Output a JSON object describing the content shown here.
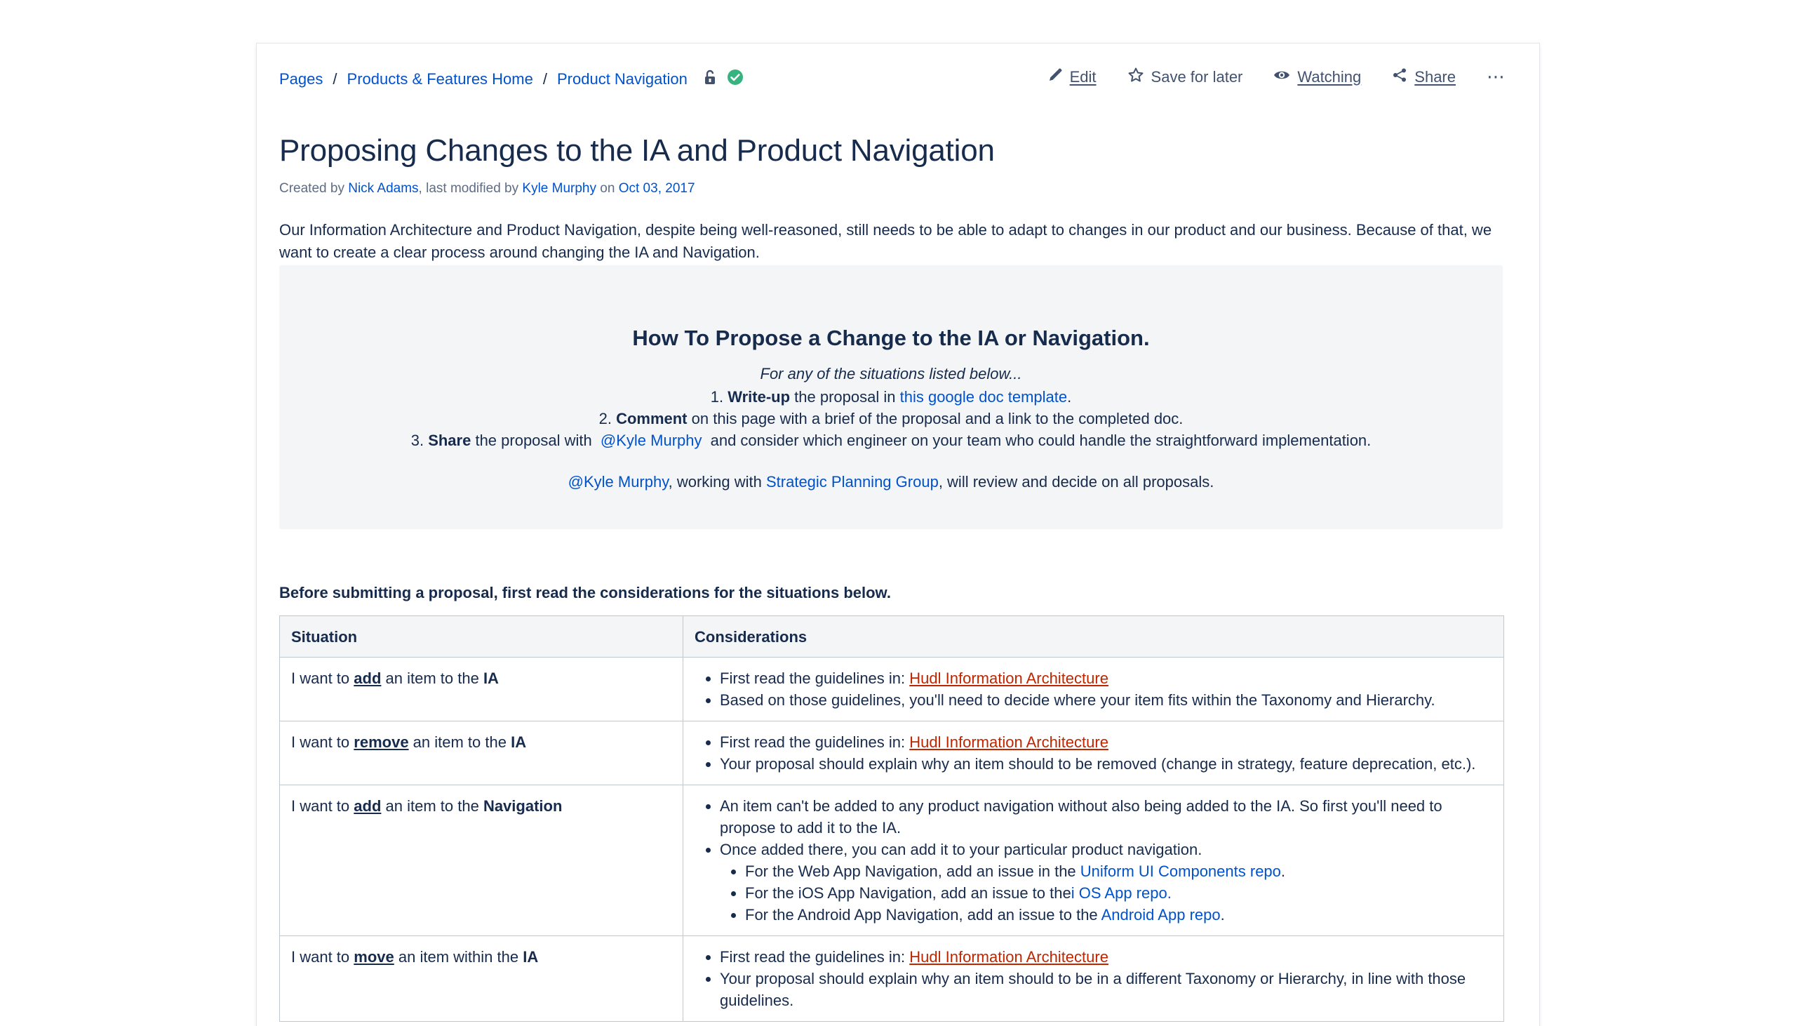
{
  "breadcrumb": {
    "pages": "Pages",
    "home": "Products & Features Home",
    "current": "Product Navigation",
    "separator": "/"
  },
  "icons": {
    "restriction": "unlock-icon",
    "status": "check-circle-icon",
    "edit": "pencil-icon",
    "save": "star-icon",
    "watch": "eye-icon",
    "share": "share-icon",
    "more": "more-dots-icon"
  },
  "actions": {
    "edit": "Edit",
    "save": "Save for later",
    "watch": "Watching",
    "share": "Share",
    "more": "⋯"
  },
  "page": {
    "title": "Proposing Changes to the IA and Product Navigation",
    "created_by_label": "Created by",
    "creator": "Nick Adams",
    "modified_label": ", last modified by",
    "modifier": "Kyle Murphy",
    "on_label": "on",
    "date": "Oct 03, 2017",
    "intro": "Our Information Architecture and Product Navigation, despite being well-reasoned, still needs to be able to adapt to changes in our product and our business. Because of that, we want to create a clear process around changing the IA and Navigation."
  },
  "panel": {
    "heading": "How To Propose a Change to the IA or Navigation.",
    "lead": "For any of the situations listed below...",
    "step1": {
      "num": "1.",
      "bold": "Write-up",
      "text": " the proposal in ",
      "link": "this google doc template",
      "end": "."
    },
    "step2": {
      "num": "2.",
      "bold": "Comment",
      "text": " on this page with a brief of the proposal and a link to the completed doc."
    },
    "step3": {
      "num": "3.",
      "bold": "Share",
      "text": " the proposal with ",
      "mention": "@Kyle Murphy",
      "end": " and consider which engineer on your team who could handle the straightforward implementation."
    },
    "review": {
      "mention": "@Kyle Murphy",
      "text1": ", working with ",
      "link": "Strategic Planning Group",
      "text2": ", will review and decide on all proposals."
    }
  },
  "before_text": "Before submitting a proposal, first read the considerations for the situations below.",
  "table": {
    "headers": [
      "Situation",
      "Considerations"
    ],
    "rows": [
      {
        "s_pre": "I want to ",
        "s_verb": "add",
        "s_mid": " an item to the ",
        "s_obj": "IA",
        "c1_text": "First read the guidelines in: ",
        "c1_link": "Hudl Information Architecture",
        "c2": "Based on those guidelines, you'll need to decide where your item fits within the Taxonomy and Hierarchy."
      },
      {
        "s_pre": "I want to ",
        "s_verb": "remove",
        "s_mid": " an item to the ",
        "s_obj": "IA",
        "c1_text": "First read the guidelines in: ",
        "c1_link": "Hudl Information Architecture",
        "c2": "Your proposal should explain why an item should to be removed (change in strategy, feature deprecation, etc.)."
      },
      {
        "s_pre": "I want to ",
        "s_verb": "add",
        "s_mid": " an item to the ",
        "s_obj": "Navigation",
        "c1": "An item can't be added to any product navigation without also being added to the IA. So first you'll need to propose to add it to the IA.",
        "c2": "Once added there, you can add it to your particular product navigation.",
        "sub1_text": "For the Web App Navigation, add an issue in the ",
        "sub1_link": "Uniform UI Components repo",
        "sub1_end": ".",
        "sub2_text": "For the iOS App Navigation, add an issue to the",
        "sub2_link": "i OS App repo.",
        "sub3_text": "For the Android App Navigation, add an issue to the ",
        "sub3_link": "Android App repo",
        "sub3_end": "."
      },
      {
        "s_pre": "I want to ",
        "s_verb": "move",
        "s_mid": " an item within the ",
        "s_obj": "IA",
        "c1_text": "First read the guidelines in: ",
        "c1_link": "Hudl Information Architecture",
        "c2": "Your proposal should explain why an item should to be in a different Taxonomy or Hierarchy, in line with those guidelines."
      }
    ]
  },
  "colors": {
    "link": "#0052cc",
    "text": "#172b4d",
    "panel": "#f4f5f7",
    "status": "#36b37e",
    "red_link": "#bf2600"
  }
}
